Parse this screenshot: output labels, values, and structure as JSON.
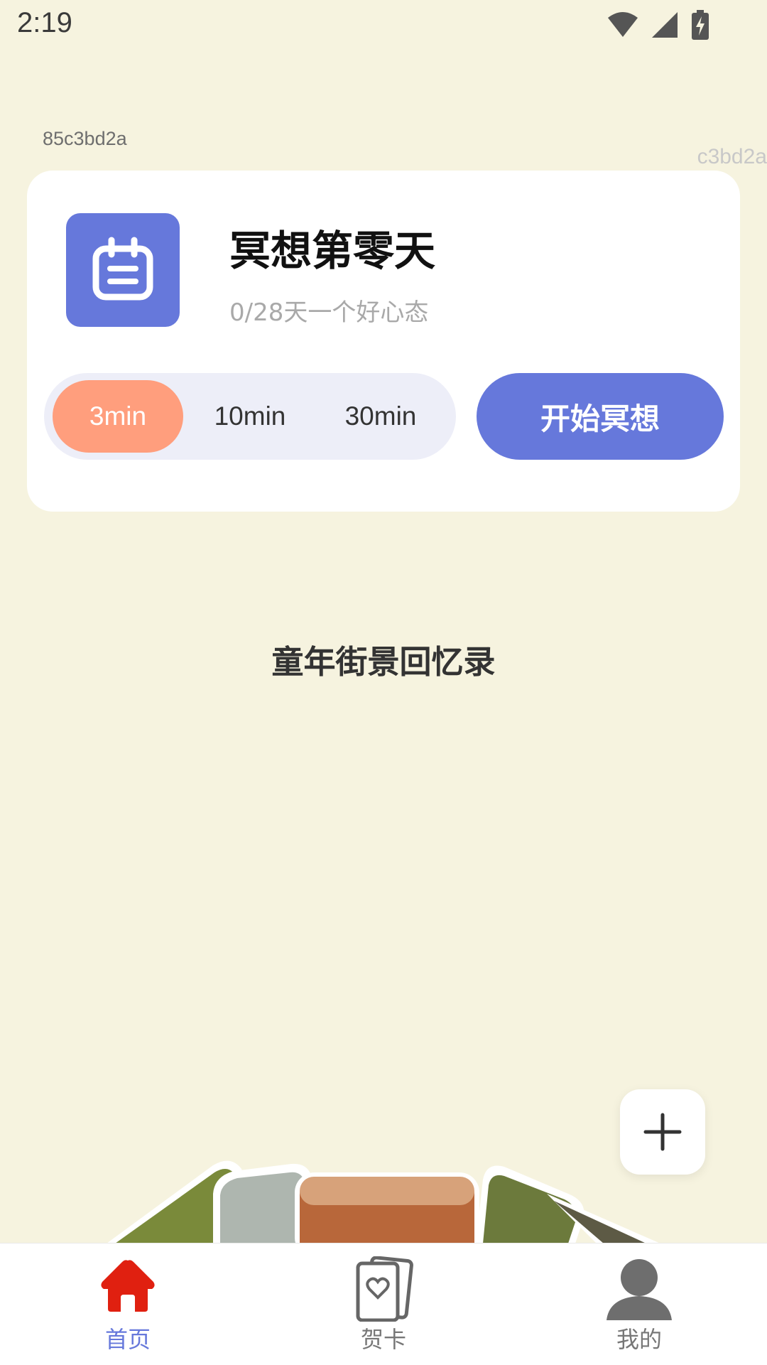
{
  "status_bar": {
    "time": "2:19"
  },
  "debug_id_left": "85c3bd2a",
  "debug_id_right": "c3bd2a",
  "meditation_card": {
    "title": "冥想第零天",
    "subtitle": "0/28天一个好心态",
    "durations": [
      {
        "label": "3min",
        "selected": true
      },
      {
        "label": "10min",
        "selected": false
      },
      {
        "label": "30min",
        "selected": false
      }
    ],
    "start_button": "开始冥想"
  },
  "section_title": "童年街景回忆录",
  "bottom_nav": {
    "items": [
      {
        "label": "首页",
        "icon": "home-icon",
        "active": true
      },
      {
        "label": "贺卡",
        "icon": "greeting-card-icon",
        "active": false
      },
      {
        "label": "我的",
        "icon": "profile-icon",
        "active": false
      }
    ]
  },
  "colors": {
    "background": "#F6F3DF",
    "accent": "#6678DB",
    "selected_duration": "#FF9E7D",
    "home_active": "#E02010"
  }
}
